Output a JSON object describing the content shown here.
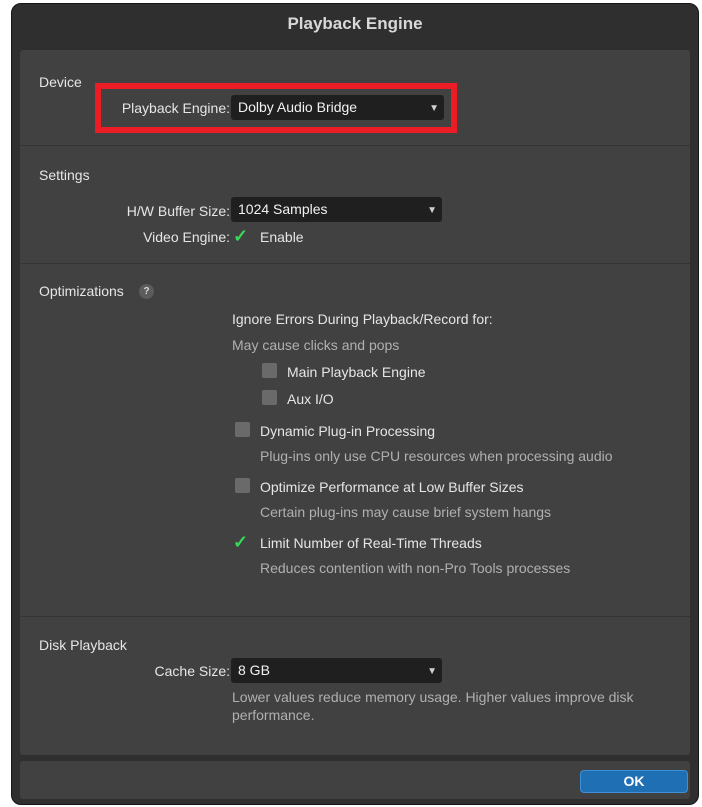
{
  "window": {
    "title": "Playback Engine"
  },
  "device": {
    "section_title": "Device",
    "engine_label": "Playback Engine:",
    "engine_value": "Dolby Audio Bridge"
  },
  "settings": {
    "section_title": "Settings",
    "buffer_label": "H/W Buffer Size:",
    "buffer_value": "1024 Samples",
    "video_label": "Video Engine:",
    "video_option": "Enable",
    "video_checked": true
  },
  "optimizations": {
    "section_title": "Optimizations",
    "help_glyph": "?",
    "ignore_errors_heading": "Ignore Errors During Playback/Record for:",
    "ignore_errors_note": "May cause clicks and pops",
    "main_playback_engine": "Main Playback Engine",
    "aux_io": "Aux I/O",
    "dynamic_plugin": "Dynamic Plug-in Processing",
    "dynamic_plugin_note": "Plug-ins only use CPU resources when processing audio",
    "optimize_perf": "Optimize Performance at Low Buffer Sizes",
    "optimize_perf_note": "Certain plug-ins may cause brief system hangs",
    "limit_threads": "Limit Number of Real-Time Threads",
    "limit_threads_note": "Reduces contention with non-Pro Tools processes",
    "limit_threads_checked": true
  },
  "disk": {
    "section_title": "Disk Playback",
    "cache_label": "Cache Size:",
    "cache_value": "8 GB",
    "cache_note_line1": "Lower values reduce memory usage. Higher values improve disk",
    "cache_note_line2": "performance."
  },
  "footer": {
    "ok_label": "OK"
  },
  "icons": {
    "dropdown": "chevron-down-icon",
    "check": "checkmark-icon",
    "help": "help-icon"
  },
  "colors": {
    "highlight": "#ec1c24",
    "check": "#39d957",
    "ok_button": "#1f6fb5"
  }
}
